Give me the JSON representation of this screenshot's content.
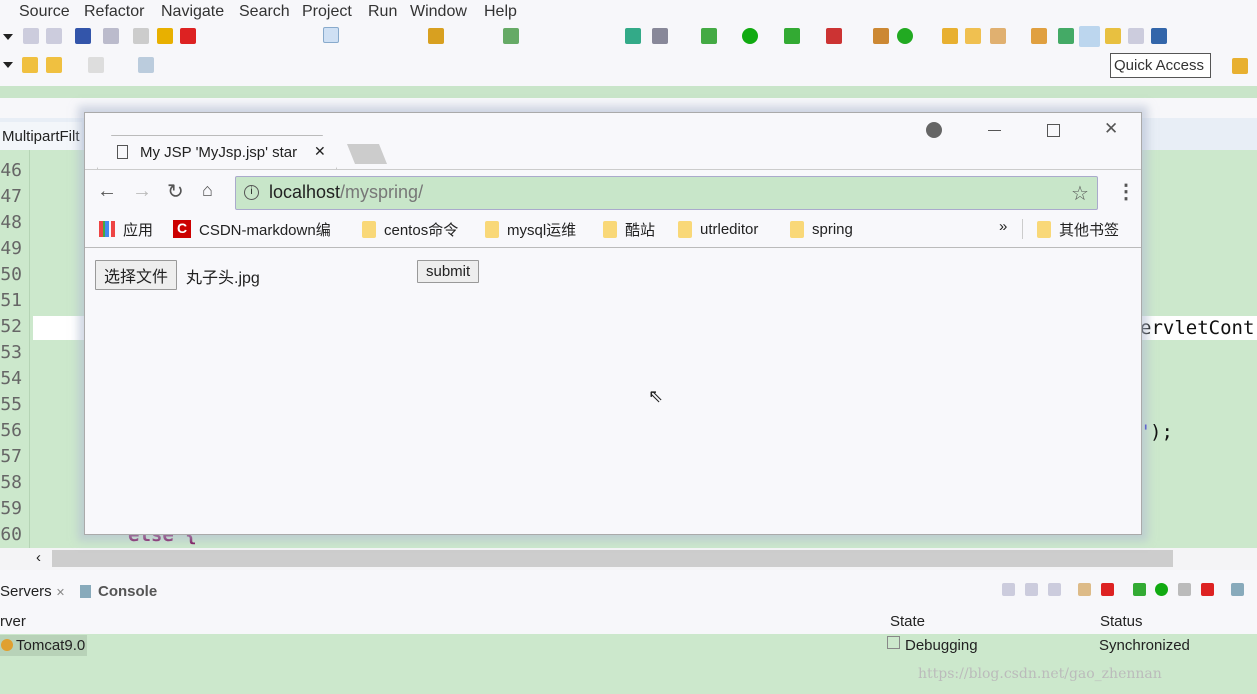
{
  "menu": [
    "Source",
    "Refactor",
    "Navigate",
    "Search",
    "Project",
    "Run",
    "Window",
    "Help"
  ],
  "quick_access": "Quick Access",
  "editor": {
    "tab": "MultipartFilt",
    "line_numbers": [
      "46",
      "47",
      "48",
      "49",
      "50",
      "51",
      "52",
      "53",
      "54",
      "55",
      "56",
      "57",
      "58",
      "59",
      "60"
    ],
    "code_fragments": {
      "line52": "ervletCont",
      "line56_quote": "'",
      "line56": ");",
      "line60": "else {"
    }
  },
  "browser": {
    "tab_title": "My JSP 'MyJsp.jsp' star",
    "url_host": "localhost",
    "url_path": "/myspring/",
    "bookmarks": [
      "应用",
      "CSDN-markdown编",
      "centos命令",
      "mysql运维",
      "酷站",
      "utrleditor",
      "spring"
    ],
    "more": "»",
    "other_bookmarks": "其他书签",
    "file_button": "选择文件",
    "file_name": "丸子头.jpg",
    "submit": "submit"
  },
  "servers": {
    "tab": "Servers",
    "close": "✕",
    "console_tab": "Console",
    "columns": [
      "rver",
      "State",
      "Status"
    ],
    "row": {
      "name": "Tomcat9.0",
      "state": "Debugging",
      "status": "Synchronized"
    }
  },
  "watermark": "https://blog.csdn.net/gao_zhennan",
  "colors": {
    "editor_bg": "#cce8cc",
    "addr_bg": "#c8e6c9"
  }
}
